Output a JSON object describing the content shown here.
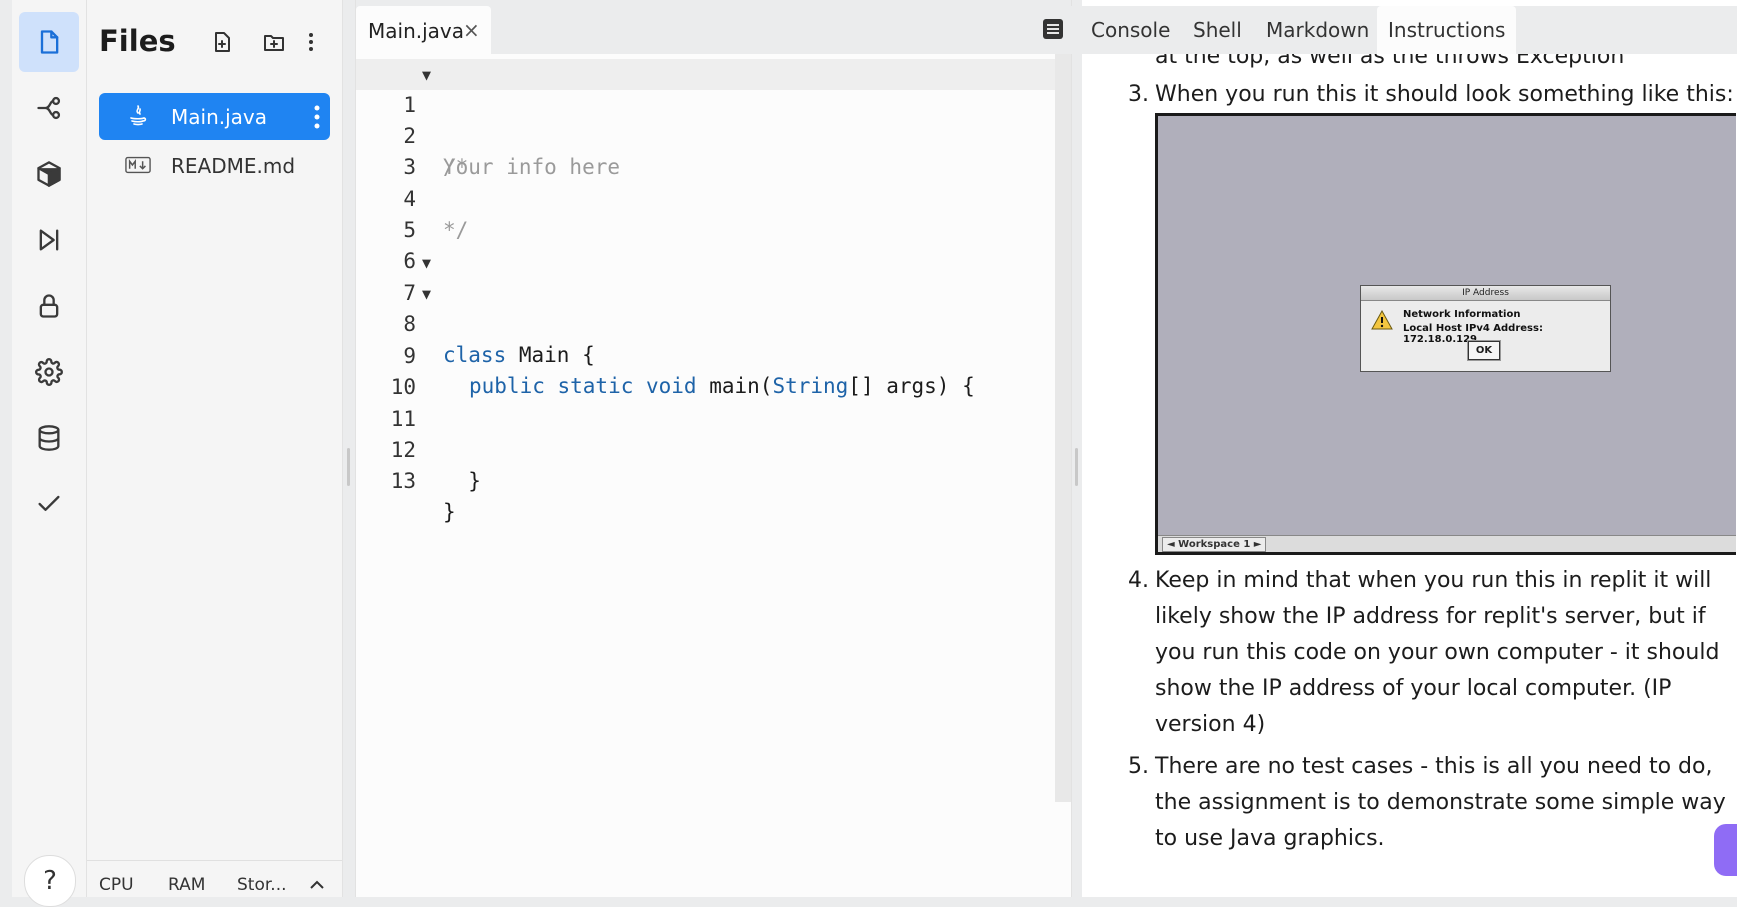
{
  "sidebar": {
    "icons": [
      "files-icon",
      "git-branch-icon",
      "packages-icon",
      "debugger-icon",
      "secrets-lock-icon",
      "settings-gear-icon",
      "database-icon",
      "check-icon"
    ],
    "help_label": "?"
  },
  "files_panel": {
    "title": "Files",
    "files": [
      {
        "name": "Main.java",
        "icon": "java-icon",
        "active": true
      },
      {
        "name": "README.md",
        "icon": "markdown-icon",
        "active": false
      }
    ],
    "resources": {
      "cpu": "CPU",
      "ram": "RAM",
      "storage": "Stor..."
    }
  },
  "editor": {
    "tab_label": "Main.java",
    "close_glyph": "×",
    "lines": [
      {
        "n": "1",
        "fold": "▼"
      },
      {
        "n": "2"
      },
      {
        "n": "3"
      },
      {
        "n": "4"
      },
      {
        "n": "5"
      },
      {
        "n": "6"
      },
      {
        "n": "7",
        "fold": "▼"
      },
      {
        "n": "8",
        "fold": "▼"
      },
      {
        "n": "9"
      },
      {
        "n": "10"
      },
      {
        "n": "11"
      },
      {
        "n": "12"
      },
      {
        "n": "13"
      }
    ],
    "code": {
      "l1": "/*",
      "l2": "Your info here",
      "l4": "*/",
      "l7_kw": "class",
      "l7_rest": " Main {",
      "l8_kw": "public static void",
      "l8_fn": " main(",
      "l8_type": "String",
      "l8_rest": "[] args) {",
      "l12": "  }",
      "l13": "}"
    }
  },
  "right_tabs": [
    "Console",
    "Shell",
    "Markdown",
    "Instructions"
  ],
  "right_active_tab": "Instructions",
  "instructions": {
    "cut_line": "at the top, as well as the throws Exception",
    "items": [
      {
        "num": "3.",
        "lines": [
          "When you run this it should look something like this:"
        ]
      },
      {
        "num": "4.",
        "lines": [
          "Keep in mind that when you run this in replit it will",
          "likely show the IP address for replit's server, but if",
          "you run this code on your own computer - it should",
          "show the IP address of your local computer. (IP",
          "version 4)"
        ]
      },
      {
        "num": "5.",
        "lines": [
          "There are no test cases - this is all you need to do,",
          "the assignment is to demonstrate some simple way",
          "to use Java graphics."
        ]
      }
    ],
    "screenshot": {
      "dialog_title": "IP Address",
      "line1": "Network Information",
      "line2": "Local Host IPv4 Address: 172.18.0.129",
      "ok": "OK",
      "workspace": "◄ Workspace 1 ►"
    }
  },
  "colors": {
    "accent": "#1f84f2",
    "keyword": "#1e63a8",
    "comment": "#9a9a9a",
    "chat": "#8f6cf5"
  }
}
